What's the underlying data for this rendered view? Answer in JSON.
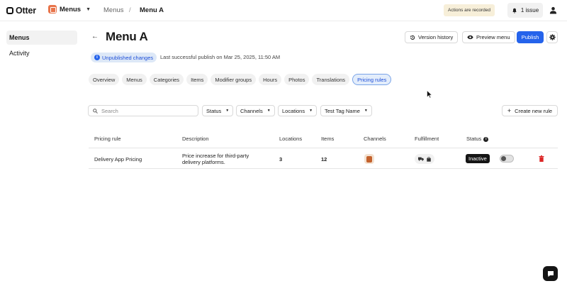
{
  "brand": {
    "name": "Otter"
  },
  "app_switcher": {
    "label": "Menus"
  },
  "breadcrumb": {
    "parent": "Menus",
    "separator": "/",
    "current": "Menu A"
  },
  "notice": {
    "recorded": "Actions are recorded"
  },
  "issues": {
    "label": "1 issue"
  },
  "sidebar": {
    "items": [
      {
        "label": "Menus",
        "active": true
      },
      {
        "label": "Activity",
        "active": false
      }
    ]
  },
  "page": {
    "title": "Menu A"
  },
  "actions": {
    "version_history": "Version history",
    "preview_menu": "Preview menu",
    "publish": "Publish"
  },
  "status_banner": {
    "badge": "Unpublished changes",
    "last_publish": "Last successful publish on Mar 25, 2025, 11:50 AM"
  },
  "tabs": [
    {
      "label": "Overview",
      "active": false
    },
    {
      "label": "Menus",
      "active": false
    },
    {
      "label": "Categories",
      "active": false
    },
    {
      "label": "Items",
      "active": false
    },
    {
      "label": "Modifier groups",
      "active": false
    },
    {
      "label": "Hours",
      "active": false
    },
    {
      "label": "Photos",
      "active": false
    },
    {
      "label": "Translations",
      "active": false
    },
    {
      "label": "Pricing rules",
      "active": true
    }
  ],
  "filters": {
    "search_placeholder": "Search",
    "status": "Status",
    "channels": "Channels",
    "locations": "Locations",
    "tag": "Test Tag Name",
    "create": "Create new rule"
  },
  "table": {
    "headers": {
      "rule": "Pricing rule",
      "description": "Description",
      "locations": "Locations",
      "items": "Items",
      "channels": "Channels",
      "fulfillment": "Fulfillment",
      "status": "Status"
    },
    "rows": [
      {
        "rule": "Delivery App Pricing",
        "description_line1": "Price increase for third-party",
        "description_line2": "delivery platforms.",
        "locations": "3",
        "items": "12",
        "status": "Inactive",
        "enabled": false
      }
    ]
  },
  "colors": {
    "primary": "#2563eb",
    "accent": "#e8744a",
    "danger": "#dc2626"
  }
}
